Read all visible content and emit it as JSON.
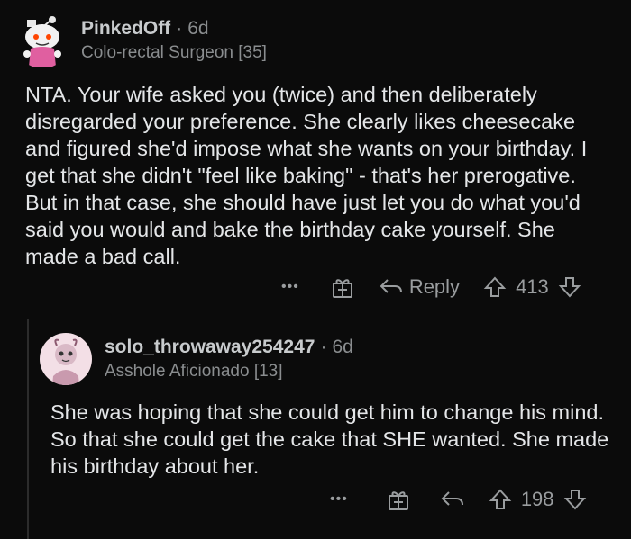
{
  "comment1": {
    "username": "PinkedOff",
    "separator": "·",
    "age": "6d",
    "flair": "Colo-rectal Surgeon [35]",
    "body": "NTA. Your wife asked you (twice) and then deliberately disregarded your preference. She clearly likes cheesecake and figured she'd impose what she wants on your birthday. I get that she didn't \"feel like baking\" - that's her prerogative. But in that case, she should have just let you do what you'd said you would and bake the birthday cake yourself. She made a bad call.",
    "actions": {
      "more": "•••",
      "reply_label": "Reply",
      "score": "413"
    }
  },
  "comment2": {
    "username": "solo_throwaway254247",
    "separator": "·",
    "age": "6d",
    "flair": "Asshole Aficionado [13]",
    "body": "She was hoping that she could get him to change his mind. So that she could get the cake that SHE wanted. She made his birthday about her.",
    "actions": {
      "more": "•••",
      "score": "198"
    }
  },
  "colors": {
    "background": "#0b0b0b",
    "text": "#e4e6e8",
    "muted": "#8a8d8f",
    "avatar1": "#e8e8e8",
    "avatar2_bg": "#f3dfe6"
  },
  "icons": [
    "snoo-avatar-icon",
    "snoo-avatar-icon",
    "award-gift-icon",
    "reply-arrow-icon",
    "upvote-arrow-icon",
    "downvote-arrow-icon"
  ]
}
